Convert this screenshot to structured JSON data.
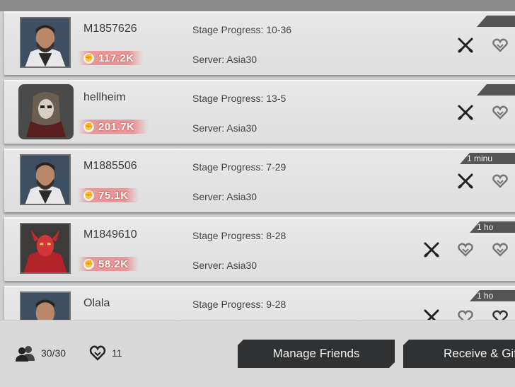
{
  "friends": [
    {
      "name": "M1857626",
      "power": "117.2K",
      "stage": "Stage Progress: 10-36",
      "server": "Server: Asia30",
      "time": "",
      "avatar": "bearded-man"
    },
    {
      "name": "hellheim",
      "power": "201.7K",
      "stage": "Stage Progress: 13-5",
      "server": "Server: Asia30",
      "time": "",
      "avatar": "masked-soldier"
    },
    {
      "name": "M1885506",
      "power": "75.1K",
      "stage": "Stage Progress: 7-29",
      "server": "Server: Asia30",
      "time": "1 minu",
      "avatar": "bearded-man"
    },
    {
      "name": "M1849610",
      "power": "58.2K",
      "stage": "Stage Progress: 8-28",
      "server": "Server: Asia30",
      "time": "1 ho",
      "avatar": "red-demon"
    },
    {
      "name": "Olala",
      "power": "",
      "stage": "Stage Progress: 9-28",
      "server": "",
      "time": "1 ho",
      "avatar": "bearded-man"
    }
  ],
  "footer": {
    "friend_count": "30/30",
    "heart_count": "11",
    "manage_label": "Manage Friends",
    "receive_label": "Receive & Gif"
  },
  "icons": {
    "battle": "crossed-swords-icon",
    "gift": "heart-icon",
    "power": "fist-icon",
    "friends": "friends-icon"
  },
  "colors": {
    "power_banner": "#eb5a5a",
    "button_bg": "#2f3133",
    "card_bg": "#e4e4e4"
  }
}
